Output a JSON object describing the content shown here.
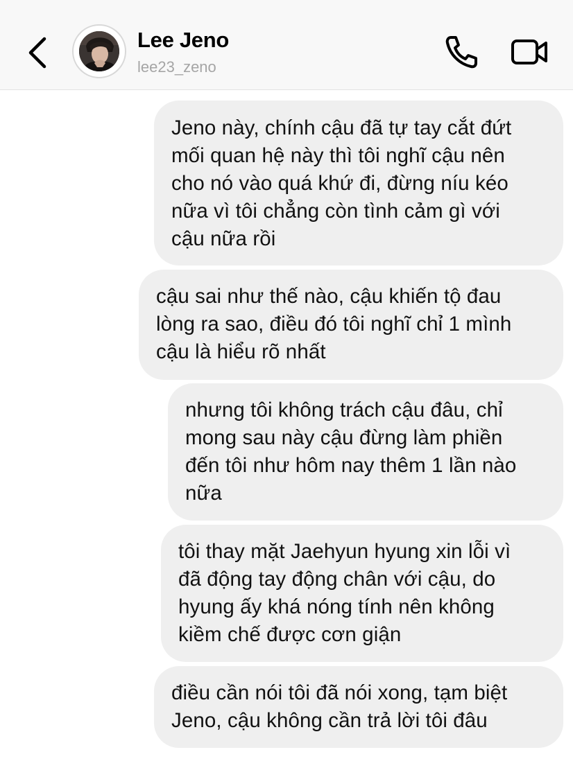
{
  "header": {
    "contact_name": "Lee Jeno",
    "contact_username": "lee23_zeno",
    "icons": {
      "back": "chevron-left-icon",
      "call": "phone-icon",
      "video": "video-camera-icon"
    }
  },
  "messages": [
    {
      "text": "Jeno này, chính cậu đã tự tay cắt đứt\nmối quan hệ này thì tôi nghĩ cậu nên\ncho nó vào quá khứ đi, đừng níu kéo\nnữa vì tôi chẳng còn tình cảm gì với\ncậu nữa rồi"
    },
    {
      "text": "cậu sai như thế nào, cậu khiến tộ đau\nlòng ra sao, điều đó tôi nghĩ chỉ 1 mình\ncậu là hiểu rõ nhất"
    },
    {
      "text": "nhưng tôi không trách cậu đâu, chỉ\nmong sau này cậu đừng làm phiền\nđến tôi như hôm nay thêm 1 lần nào\nnữa"
    },
    {
      "text": "tôi thay mặt Jaehyun hyung xin lỗi vì\nđã động tay động chân với cậu, do\nhyung ấy khá nóng tính nên không\nkiềm chế được cơn giận"
    },
    {
      "text": "điều cần nói tôi đã nói xong, tạm biệt\nJeno, cậu không cần trả lời tôi đâu"
    }
  ],
  "colors": {
    "header_bg": "#f8f8f8",
    "bubble_bg": "#efefef",
    "username_gray": "#a5a5a5",
    "text": "#111111"
  }
}
